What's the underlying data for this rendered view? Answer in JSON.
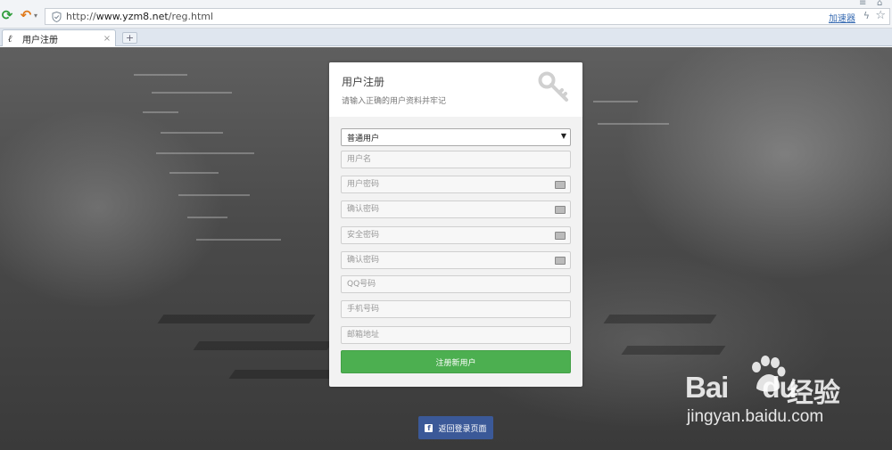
{
  "browser": {
    "url_prefix": "http://",
    "url_host": "www.yzm8.net",
    "url_path": "/reg.html",
    "accelerator_label": "加速器",
    "tab_title": "用户注册",
    "tab_favicon": "ℓ",
    "newtab_label": "+",
    "close_label": "×"
  },
  "card": {
    "title": "用户注册",
    "subtitle": "请输入正确的用户资料并牢记",
    "user_type": {
      "selected": "普通用户"
    },
    "fields": {
      "username": "用户名",
      "password": "用户密码",
      "confirm_password": "确认密码",
      "security_password": "安全密码",
      "confirm_security_password": "确认密码",
      "qq": "QQ号码",
      "phone": "手机号码",
      "email": "邮箱地址"
    },
    "submit_label": "注册新用户"
  },
  "back_button": {
    "icon": "f",
    "label": "返回登录页面"
  },
  "watermark": {
    "brand": "Bai",
    "brand_du": "du",
    "brand_cn": "经验",
    "url": "jingyan.baidu.com"
  },
  "colors": {
    "submit": "#4caf50",
    "back_button": "#3b5998",
    "accelerator_link": "#3a6db3"
  }
}
